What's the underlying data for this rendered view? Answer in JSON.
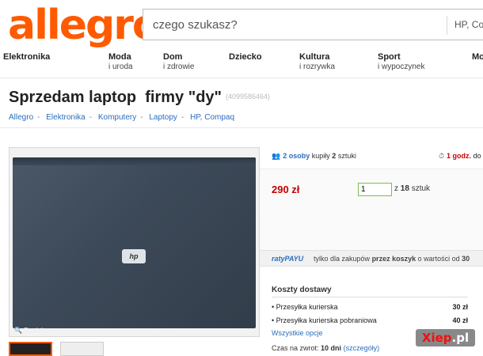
{
  "header": {
    "logo": "allegro",
    "search_placeholder": "czego szukasz?",
    "search_category": "HP, Co"
  },
  "nav": [
    {
      "title": "Elektronika",
      "sub": ""
    },
    {
      "title": "Moda",
      "sub": "i uroda"
    },
    {
      "title": "Dom",
      "sub": "i zdrowie"
    },
    {
      "title": "Dziecko",
      "sub": ""
    },
    {
      "title": "Kultura",
      "sub": "i rozrywka"
    },
    {
      "title": "Sport",
      "sub": "i wypoczynek"
    },
    {
      "title": "Mo",
      "sub": ""
    }
  ],
  "offer": {
    "title": "Sprzedam laptop  firmy \"dy\"",
    "id": "(4099586464)"
  },
  "breadcrumb": [
    "Allegro",
    "Elektronika",
    "Komputery",
    "Laptopy",
    "HP, Compaq"
  ],
  "gallery": {
    "zoom_label": "Powiększ",
    "logo_text": "hp"
  },
  "buyers": {
    "count_label": "2 osoby",
    "text": "kupiły",
    "qty": "2",
    "unit": "sztuki"
  },
  "timer": {
    "label": "1 godz.",
    "rest": "do"
  },
  "price": {
    "value": "290 zł",
    "qty_value": "1",
    "of_prefix": "z",
    "of_count": "18",
    "of_unit": "sztuk"
  },
  "raty": {
    "logo": "ratyPAYU",
    "text_a": "tylko dla zakupów",
    "text_b": "przez koszyk",
    "text_c": "o wartości od",
    "text_d": "30"
  },
  "shipping": {
    "heading": "Koszty dostawy",
    "rows": [
      {
        "name": "Przesyłka kurierska",
        "price": "30 zł"
      },
      {
        "name": "Przesyłka kurierska pobraniowa",
        "price": "40 zł"
      }
    ],
    "all_options": "Wszystkie opcje",
    "return_prefix": "Czas na zwrot:",
    "return_days": "10 dni",
    "return_link": "(szczegóły)"
  },
  "watermark": {
    "a": "Xiep",
    "b": ".pl"
  }
}
